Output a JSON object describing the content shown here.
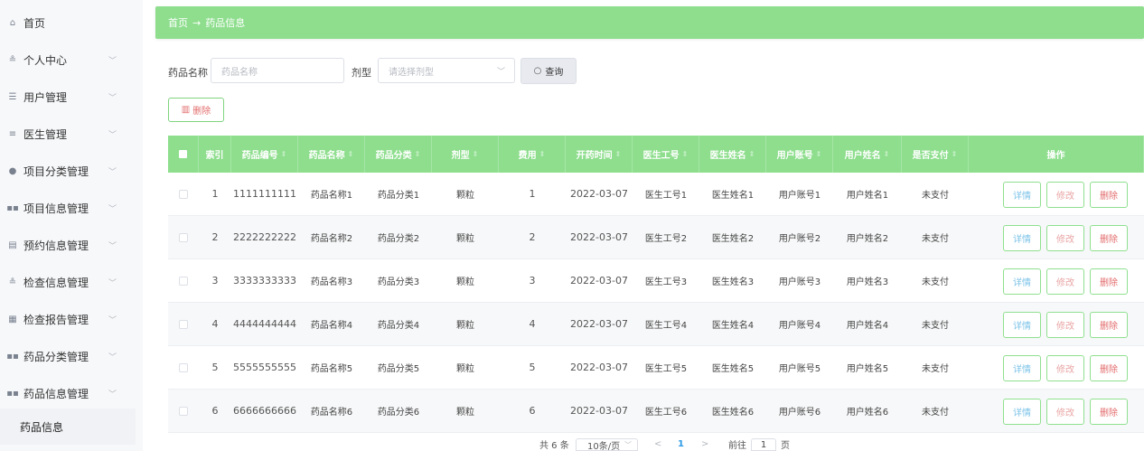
{
  "sidebar": {
    "items": [
      {
        "label": "首页",
        "icon": "home-icon",
        "glyph": "⌂",
        "has_arrow": false
      },
      {
        "label": "个人中心",
        "icon": "person-icon",
        "glyph": "≗",
        "has_arrow": true
      },
      {
        "label": "用户管理",
        "icon": "sliders-icon",
        "glyph": "☰",
        "has_arrow": true
      },
      {
        "label": "医生管理",
        "icon": "list-icon",
        "glyph": "≡",
        "has_arrow": true
      },
      {
        "label": "项目分类管理",
        "icon": "pin-icon",
        "glyph": "●",
        "has_arrow": true
      },
      {
        "label": "项目信息管理",
        "icon": "grid-icon",
        "glyph": "▪▪",
        "has_arrow": true
      },
      {
        "label": "预约信息管理",
        "icon": "document-icon",
        "glyph": "▤",
        "has_arrow": true
      },
      {
        "label": "检查信息管理",
        "icon": "person-icon",
        "glyph": "≗",
        "has_arrow": true
      },
      {
        "label": "检查报告管理",
        "icon": "table-icon",
        "glyph": "▦",
        "has_arrow": true
      },
      {
        "label": "药品分类管理",
        "icon": "grid-icon",
        "glyph": "▪▪",
        "has_arrow": true
      },
      {
        "label": "药品信息管理",
        "icon": "grid-icon",
        "glyph": "▪▪",
        "has_arrow": true
      }
    ],
    "sub_item": "药品信息"
  },
  "breadcrumb": {
    "home": "首页",
    "arrow": "→",
    "current": "药品信息"
  },
  "search": {
    "name_label": "药品名称",
    "name_placeholder": "药品名称",
    "type_label": "剂型",
    "type_placeholder": "请选择剂型",
    "query_button": "查询"
  },
  "actions": {
    "delete_button": "删除"
  },
  "table": {
    "headers": [
      "索引",
      "药品编号",
      "药品名称",
      "药品分类",
      "剂型",
      "费用",
      "开药时间",
      "医生工号",
      "医生姓名",
      "用户账号",
      "用户姓名",
      "是否支付",
      "操作"
    ],
    "rows": [
      [
        "1",
        "1111111111",
        "药品名称1",
        "药品分类1",
        "颗粒",
        "1",
        "2022-03-07",
        "医生工号1",
        "医生姓名1",
        "用户账号1",
        "用户姓名1",
        "未支付"
      ],
      [
        "2",
        "2222222222",
        "药品名称2",
        "药品分类2",
        "颗粒",
        "2",
        "2022-03-07",
        "医生工号2",
        "医生姓名2",
        "用户账号2",
        "用户姓名2",
        "未支付"
      ],
      [
        "3",
        "3333333333",
        "药品名称3",
        "药品分类3",
        "颗粒",
        "3",
        "2022-03-07",
        "医生工号3",
        "医生姓名3",
        "用户账号3",
        "用户姓名3",
        "未支付"
      ],
      [
        "4",
        "4444444444",
        "药品名称4",
        "药品分类4",
        "颗粒",
        "4",
        "2022-03-07",
        "医生工号4",
        "医生姓名4",
        "用户账号4",
        "用户姓名4",
        "未支付"
      ],
      [
        "5",
        "5555555555",
        "药品名称5",
        "药品分类5",
        "颗粒",
        "5",
        "2022-03-07",
        "医生工号5",
        "医生姓名5",
        "用户账号5",
        "用户姓名5",
        "未支付"
      ],
      [
        "6",
        "6666666666",
        "药品名称6",
        "药品分类6",
        "颗粒",
        "6",
        "2022-03-07",
        "医生工号6",
        "医生姓名6",
        "用户账号6",
        "用户姓名6",
        "未支付"
      ]
    ],
    "op_labels": {
      "detail": "详情",
      "edit": "修改",
      "delete": "删除"
    }
  },
  "pagination": {
    "total": "共 6 条",
    "page_size": "10条/页",
    "prev": "<",
    "current": "1",
    "next": ">",
    "goto_prefix": "前往",
    "goto_value": "1",
    "goto_suffix": "页"
  },
  "colors": {
    "accent": "#8ede8e",
    "danger": "#e36b6b",
    "info": "#7cc3e8"
  }
}
